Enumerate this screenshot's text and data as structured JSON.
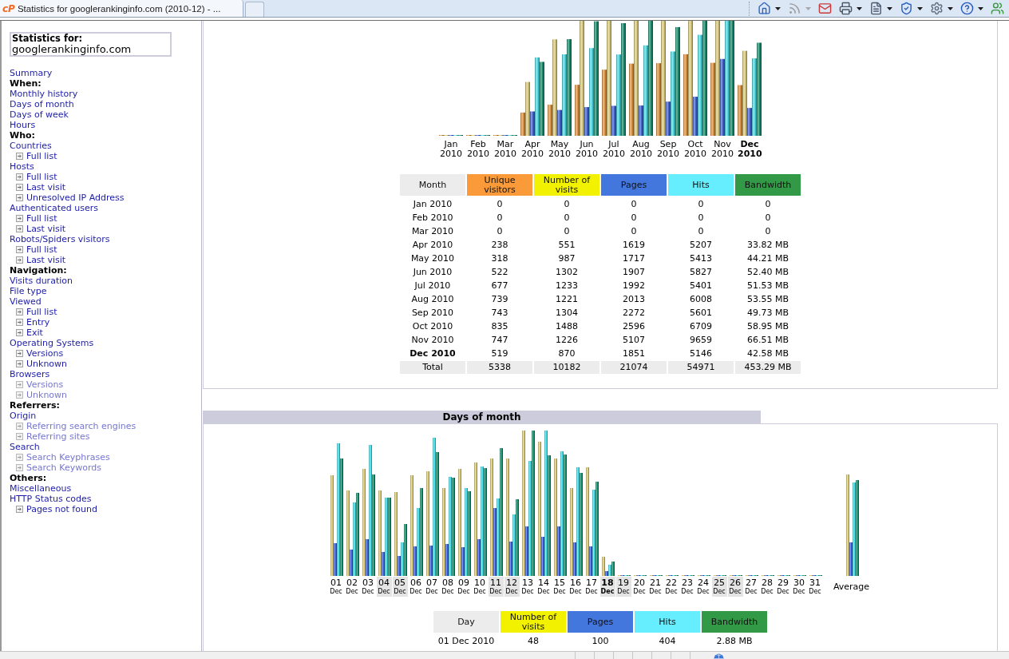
{
  "browser": {
    "tab": {
      "favicon_text": "cP",
      "title": "Statistics for googlerankinginfo.com (2010-12) - ..."
    },
    "toolbar": [
      {
        "kind": "home",
        "dropdown": true,
        "disabled": false
      },
      {
        "kind": "feeds",
        "dropdown": true,
        "disabled": true
      },
      {
        "kind": "mail",
        "dropdown": false,
        "disabled": false
      },
      {
        "kind": "print",
        "dropdown": true,
        "disabled": false
      },
      {
        "kind": "page",
        "dropdown": true,
        "disabled": false
      },
      {
        "kind": "safety",
        "dropdown": true,
        "disabled": false
      },
      {
        "kind": "tools",
        "dropdown": true,
        "disabled": false
      },
      {
        "kind": "help",
        "dropdown": true,
        "disabled": false
      },
      {
        "kind": "messenger",
        "dropdown": false,
        "disabled": false
      }
    ]
  },
  "sidebar": {
    "stats_label": "Statistics for:",
    "domain": "googlerankinginfo.com",
    "items": [
      {
        "kind": "link",
        "text": "Summary"
      },
      {
        "kind": "heading",
        "text": "When:"
      },
      {
        "kind": "link",
        "text": "Monthly history"
      },
      {
        "kind": "link",
        "text": "Days of month"
      },
      {
        "kind": "link",
        "text": "Days of week"
      },
      {
        "kind": "link",
        "text": "Hours"
      },
      {
        "kind": "heading",
        "text": "Who:"
      },
      {
        "kind": "link",
        "text": "Countries",
        "children": [
          {
            "text": "Full list",
            "dimmed": false
          }
        ]
      },
      {
        "kind": "link",
        "text": "Hosts",
        "children": [
          {
            "text": "Full list",
            "dimmed": false
          },
          {
            "text": "Last visit",
            "dimmed": false
          },
          {
            "text": "Unresolved IP Address",
            "dimmed": false
          }
        ]
      },
      {
        "kind": "link",
        "text": "Authenticated users",
        "children": [
          {
            "text": "Full list",
            "dimmed": false
          },
          {
            "text": "Last visit",
            "dimmed": false
          }
        ]
      },
      {
        "kind": "link",
        "text": "Robots/Spiders visitors",
        "children": [
          {
            "text": "Full list",
            "dimmed": false
          },
          {
            "text": "Last visit",
            "dimmed": false
          }
        ]
      },
      {
        "kind": "heading",
        "text": "Navigation:"
      },
      {
        "kind": "link",
        "text": "Visits duration"
      },
      {
        "kind": "link",
        "text": "File type"
      },
      {
        "kind": "link",
        "text": "Viewed",
        "children": [
          {
            "text": "Full list",
            "dimmed": false
          },
          {
            "text": "Entry",
            "dimmed": false
          },
          {
            "text": "Exit",
            "dimmed": false
          }
        ]
      },
      {
        "kind": "link",
        "text": "Operating Systems",
        "children": [
          {
            "text": "Versions",
            "dimmed": false
          },
          {
            "text": "Unknown",
            "dimmed": false
          }
        ]
      },
      {
        "kind": "link",
        "text": "Browsers",
        "children": [
          {
            "text": "Versions",
            "dimmed": true
          },
          {
            "text": "Unknown",
            "dimmed": true
          }
        ]
      },
      {
        "kind": "heading",
        "text": "Referrers:"
      },
      {
        "kind": "link",
        "text": "Origin",
        "children": [
          {
            "text": "Referring search engines",
            "dimmed": true
          },
          {
            "text": "Referring sites",
            "dimmed": true
          }
        ]
      },
      {
        "kind": "link",
        "text": "Search",
        "children": [
          {
            "text": "Search Keyphrases",
            "dimmed": true
          },
          {
            "text": "Search Keywords",
            "dimmed": true
          }
        ]
      },
      {
        "kind": "heading",
        "text": "Others:"
      },
      {
        "kind": "link",
        "text": "Miscellaneous"
      },
      {
        "kind": "link",
        "text": "HTTP Status codes",
        "children": [
          {
            "text": "Pages not found",
            "dimmed": false
          }
        ]
      }
    ]
  },
  "monthly_history": {
    "chart": {
      "labels": [
        {
          "text": "Jan 2010",
          "current": false
        },
        {
          "text": "Feb 2010",
          "current": false
        },
        {
          "text": "Mar 2010",
          "current": false
        },
        {
          "text": "Apr 2010",
          "current": false
        },
        {
          "text": "May 2010",
          "current": false
        },
        {
          "text": "Jun 2010",
          "current": false
        },
        {
          "text": "Jul 2010",
          "current": false
        },
        {
          "text": "Aug 2010",
          "current": false
        },
        {
          "text": "Sep 2010",
          "current": false
        },
        {
          "text": "Oct 2010",
          "current": false
        },
        {
          "text": "Nov 2010",
          "current": false
        },
        {
          "text": "Dec 2010",
          "current": true
        }
      ]
    },
    "table": {
      "columns": [
        {
          "label": "Month",
          "color": "#ececec"
        },
        {
          "label": "Unique visitors",
          "color": "#fb9a38"
        },
        {
          "label": "Number of visits",
          "color": "#f2f200"
        },
        {
          "label": "Pages",
          "color": "#4477dd"
        },
        {
          "label": "Hits",
          "color": "#66eeff"
        },
        {
          "label": "Bandwidth",
          "color": "#329946"
        }
      ],
      "rows": [
        {
          "cells": [
            "Jan 2010",
            "0",
            "0",
            "0",
            "0",
            "0"
          ],
          "current": false
        },
        {
          "cells": [
            "Feb 2010",
            "0",
            "0",
            "0",
            "0",
            "0"
          ],
          "current": false
        },
        {
          "cells": [
            "Mar 2010",
            "0",
            "0",
            "0",
            "0",
            "0"
          ],
          "current": false
        },
        {
          "cells": [
            "Apr 2010",
            "238",
            "551",
            "1619",
            "5207",
            "33.82 MB"
          ],
          "current": false
        },
        {
          "cells": [
            "May 2010",
            "318",
            "987",
            "1717",
            "5413",
            "44.21 MB"
          ],
          "current": false
        },
        {
          "cells": [
            "Jun 2010",
            "522",
            "1302",
            "1907",
            "5827",
            "52.40 MB"
          ],
          "current": false
        },
        {
          "cells": [
            "Jul 2010",
            "677",
            "1233",
            "1992",
            "5401",
            "51.53 MB"
          ],
          "current": false
        },
        {
          "cells": [
            "Aug 2010",
            "739",
            "1221",
            "2013",
            "6008",
            "53.55 MB"
          ],
          "current": false
        },
        {
          "cells": [
            "Sep 2010",
            "743",
            "1304",
            "2272",
            "5601",
            "49.73 MB"
          ],
          "current": false
        },
        {
          "cells": [
            "Oct 2010",
            "835",
            "1488",
            "2596",
            "6709",
            "58.95 MB"
          ],
          "current": false
        },
        {
          "cells": [
            "Nov 2010",
            "747",
            "1226",
            "5107",
            "9659",
            "66.51 MB"
          ],
          "current": false
        },
        {
          "cells": [
            "Dec 2010",
            "519",
            "870",
            "1851",
            "5146",
            "42.58 MB"
          ],
          "current": true
        }
      ],
      "total": [
        "Total",
        "5338",
        "10182",
        "21074",
        "54971",
        "453.29 MB"
      ]
    }
  },
  "days_of_month": {
    "title": "Days of month",
    "days": [
      {
        "day": "01",
        "month": "Dec",
        "weekend": false,
        "today": false
      },
      {
        "day": "02",
        "month": "Dec",
        "weekend": false,
        "today": false
      },
      {
        "day": "03",
        "month": "Dec",
        "weekend": false,
        "today": false
      },
      {
        "day": "04",
        "month": "Dec",
        "weekend": true,
        "today": false
      },
      {
        "day": "05",
        "month": "Dec",
        "weekend": true,
        "today": false
      },
      {
        "day": "06",
        "month": "Dec",
        "weekend": false,
        "today": false
      },
      {
        "day": "07",
        "month": "Dec",
        "weekend": false,
        "today": false
      },
      {
        "day": "08",
        "month": "Dec",
        "weekend": false,
        "today": false
      },
      {
        "day": "09",
        "month": "Dec",
        "weekend": false,
        "today": false
      },
      {
        "day": "10",
        "month": "Dec",
        "weekend": false,
        "today": false
      },
      {
        "day": "11",
        "month": "Dec",
        "weekend": true,
        "today": false
      },
      {
        "day": "12",
        "month": "Dec",
        "weekend": true,
        "today": false
      },
      {
        "day": "13",
        "month": "Dec",
        "weekend": false,
        "today": false
      },
      {
        "day": "14",
        "month": "Dec",
        "weekend": false,
        "today": false
      },
      {
        "day": "15",
        "month": "Dec",
        "weekend": false,
        "today": false
      },
      {
        "day": "16",
        "month": "Dec",
        "weekend": false,
        "today": false
      },
      {
        "day": "17",
        "month": "Dec",
        "weekend": false,
        "today": false
      },
      {
        "day": "18",
        "month": "Dec",
        "weekend": true,
        "today": true
      },
      {
        "day": "19",
        "month": "Dec",
        "weekend": true,
        "today": false
      },
      {
        "day": "20",
        "month": "Dec",
        "weekend": false,
        "today": false
      },
      {
        "day": "21",
        "month": "Dec",
        "weekend": false,
        "today": false
      },
      {
        "day": "22",
        "month": "Dec",
        "weekend": false,
        "today": false
      },
      {
        "day": "23",
        "month": "Dec",
        "weekend": false,
        "today": false
      },
      {
        "day": "24",
        "month": "Dec",
        "weekend": false,
        "today": false
      },
      {
        "day": "25",
        "month": "Dec",
        "weekend": true,
        "today": false
      },
      {
        "day": "26",
        "month": "Dec",
        "weekend": true,
        "today": false
      },
      {
        "day": "27",
        "month": "Dec",
        "weekend": false,
        "today": false
      },
      {
        "day": "28",
        "month": "Dec",
        "weekend": false,
        "today": false
      },
      {
        "day": "29",
        "month": "Dec",
        "weekend": false,
        "today": false
      },
      {
        "day": "30",
        "month": "Dec",
        "weekend": false,
        "today": false
      },
      {
        "day": "31",
        "month": "Dec",
        "weekend": false,
        "today": false
      }
    ],
    "average_label": "Average",
    "table": {
      "columns": [
        {
          "label": "Day",
          "color": "#ececec"
        },
        {
          "label": "Number of visits",
          "color": "#f2f200"
        },
        {
          "label": "Pages",
          "color": "#4477dd"
        },
        {
          "label": "Hits",
          "color": "#66eeff"
        },
        {
          "label": "Bandwidth",
          "color": "#329946"
        }
      ],
      "rows": [
        {
          "cells": [
            "01 Dec 2010",
            "48",
            "100",
            "404",
            "2.88 MB"
          ]
        }
      ]
    }
  }
}
